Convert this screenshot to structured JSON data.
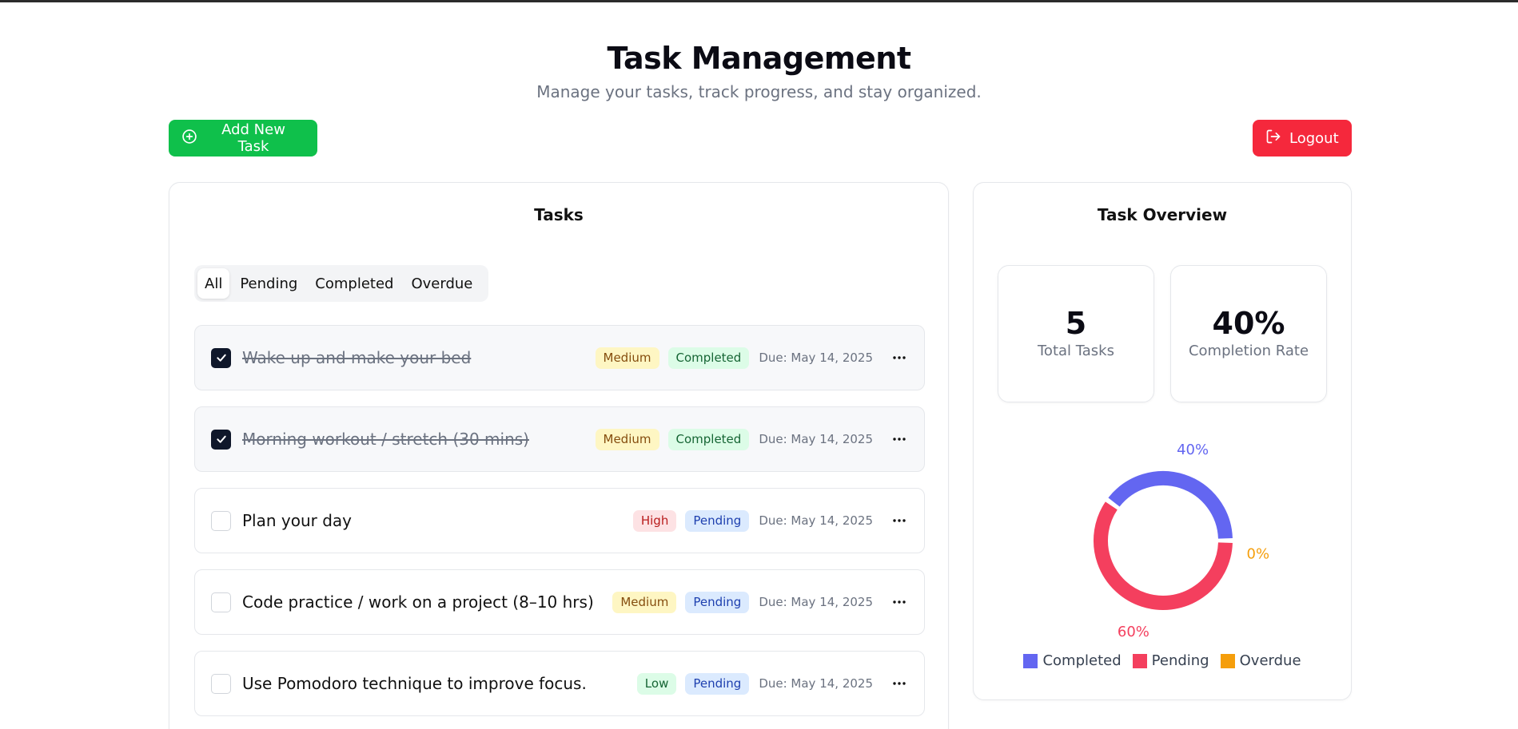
{
  "header": {
    "title": "Task Management",
    "subtitle": "Manage your tasks, track progress, and stay organized."
  },
  "actions": {
    "add_label": "Add New Task",
    "logout_label": "Logout"
  },
  "tasks_panel": {
    "title": "Tasks",
    "filters": [
      "All",
      "Pending",
      "Completed",
      "Overdue"
    ],
    "active_filter": "All",
    "tasks": [
      {
        "title": "Wake up and make your bed",
        "priority": "Medium",
        "status": "Completed",
        "due": "Due: May 14, 2025",
        "checked": true
      },
      {
        "title": "Morning workout / stretch (30 mins)",
        "priority": "Medium",
        "status": "Completed",
        "due": "Due: May 14, 2025",
        "checked": true
      },
      {
        "title": "Plan your day",
        "priority": "High",
        "status": "Pending",
        "due": "Due: May 14, 2025",
        "checked": false
      },
      {
        "title": "Code practice / work on a project (8–10 hrs)",
        "priority": "Medium",
        "status": "Pending",
        "due": "Due: May 14, 2025",
        "checked": false
      },
      {
        "title": "Use Pomodoro technique to improve focus.",
        "priority": "Low",
        "status": "Pending",
        "due": "Due: May 14, 2025",
        "checked": false
      }
    ]
  },
  "overview": {
    "title": "Task Overview",
    "total_value": "5",
    "total_label": "Total Tasks",
    "rate_value": "40%",
    "rate_label": "Completion Rate"
  },
  "chart_data": {
    "type": "pie",
    "labels": [
      "Completed",
      "Pending",
      "Overdue"
    ],
    "values": [
      40,
      60,
      0
    ],
    "value_labels": [
      "40%",
      "60%",
      "0%"
    ],
    "colors": [
      "#6366f1",
      "#f43f5e",
      "#f59e0b"
    ],
    "legend_placement": "bottom"
  },
  "colors": {
    "add_button": "#0fc04b",
    "logout_button": "#f5283c"
  },
  "icons": {
    "add": "plus-circle-icon",
    "logout": "logout-icon",
    "check": "check-icon",
    "menu": "more-horizontal-icon"
  }
}
